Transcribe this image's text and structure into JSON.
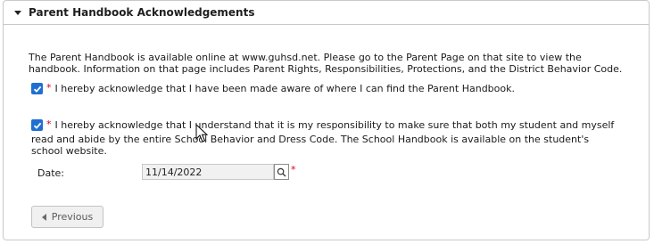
{
  "panel": {
    "title": "Parent Handbook Acknowledgements",
    "intro": "The Parent Handbook is available online at www.guhsd.net. Please go to the Parent Page on that site to view the handbook. Information on that page includes Parent Rights, Responsibilities, Protections, and the District Behavior Code."
  },
  "ack1": {
    "required": "*",
    "text": "I hereby acknowledge that I have been made aware of where I can find the Parent Handbook.",
    "checked": true
  },
  "ack2": {
    "required": "*",
    "text_line1": "I hereby acknowledge that I understand that it is my responsibility to make sure that both my student and myself",
    "text_rest": "read and abide by the entire School Behavior and Dress Code. The School Handbook is available on the student's school website.",
    "checked": true
  },
  "date": {
    "label": "Date:",
    "value": "11/14/2022",
    "required": "*"
  },
  "nav": {
    "previous_label": "Previous"
  },
  "colors": {
    "checkbox": "#1f6fd2",
    "required": "#d0021b"
  }
}
